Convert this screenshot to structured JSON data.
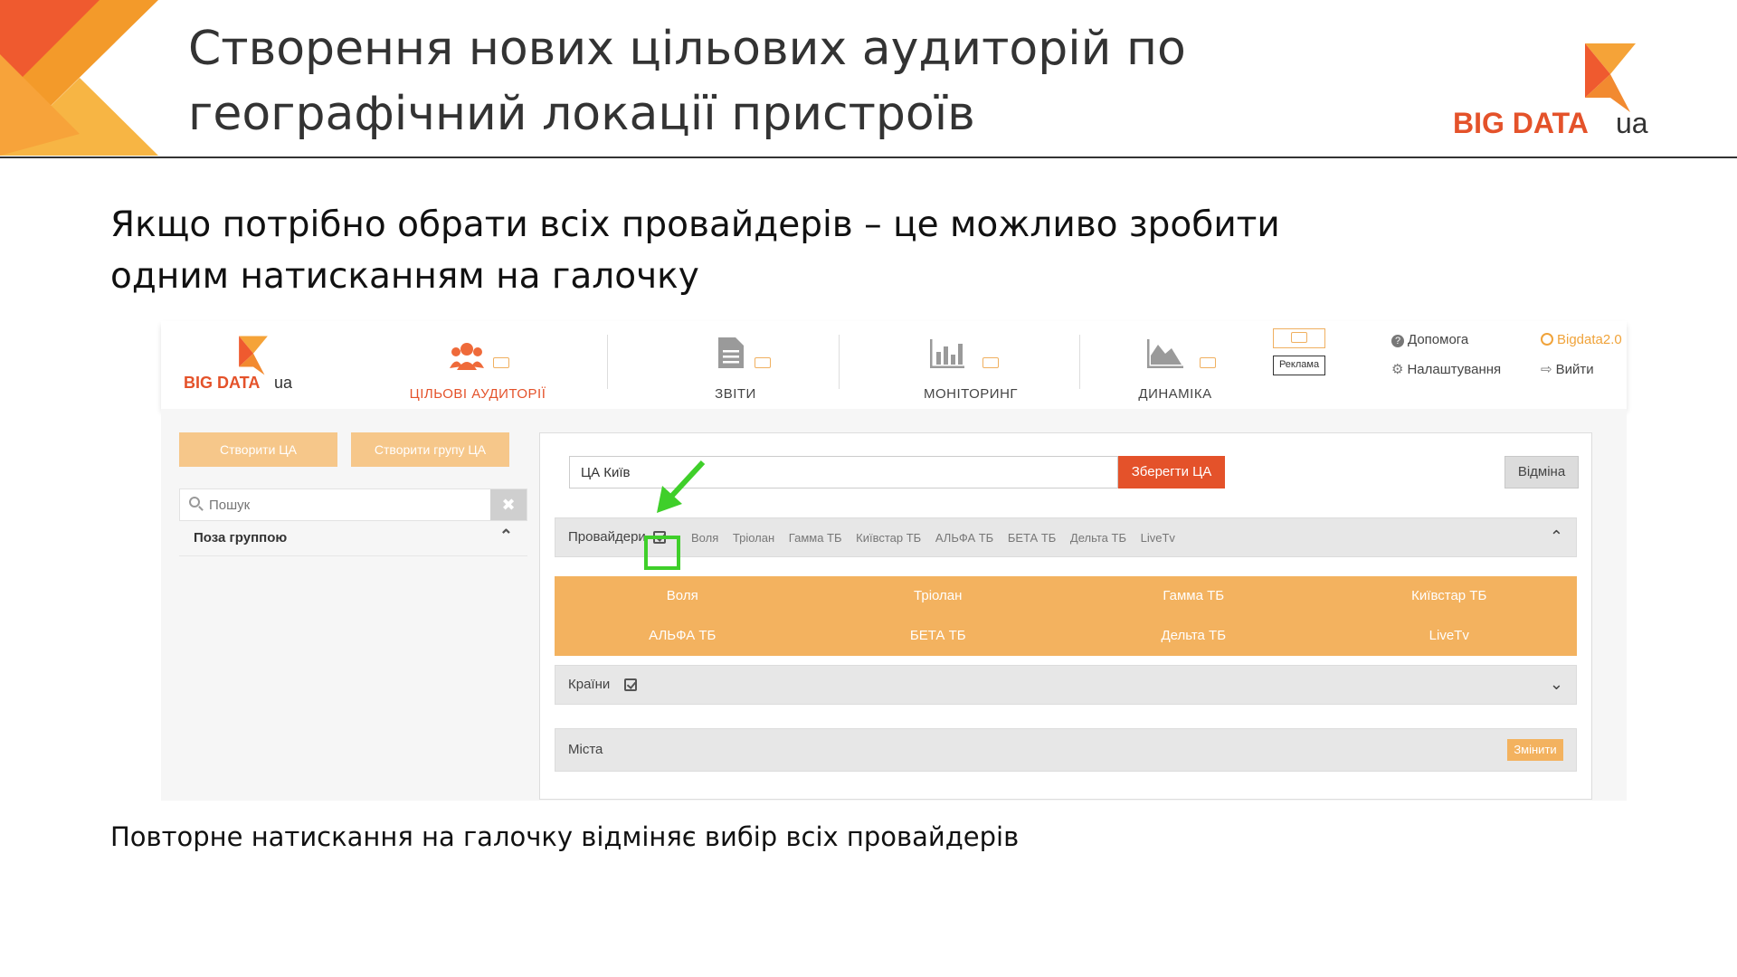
{
  "slide": {
    "title_line1": "Створення нових цільових аудиторій по",
    "title_line2": "географічний локації пристроїв",
    "logo_text": "BIG DATA",
    "logo_suffix": "ua",
    "intro_line1": "Якщо потрібно обрати всіх провайдерів – це можливо зробити",
    "intro_line2": "одним натисканням на галочку",
    "footnote": "Повторне натискання на галочку відміняє вибір всіх провайдерів"
  },
  "app": {
    "logo_text": "BIG DATA",
    "logo_suffix": "ua",
    "nav": [
      {
        "label": "ЦІЛЬОВІ АУДИТОРІЇ",
        "icon": "users-icon",
        "active": true
      },
      {
        "label": "ЗВІТИ",
        "icon": "document-icon",
        "active": false
      },
      {
        "label": "МОНІТОРИНГ",
        "icon": "bar-chart-icon",
        "active": false
      },
      {
        "label": "ДИНАМІКА",
        "icon": "area-chart-icon",
        "active": false
      }
    ],
    "ad_label": "Реклама",
    "help": "Допомога",
    "settings": "Налаштування",
    "user": "Bigdata2.0",
    "logout": "Вийти",
    "sidebar": {
      "create_ca": "Створити ЦА",
      "create_group": "Створити групу ЦА",
      "search_placeholder": "Пошук",
      "group_label": "Поза группою"
    },
    "editor": {
      "name_value": "ЦА Київ",
      "save_label": "Зберегти ЦА",
      "cancel_label": "Відміна",
      "providers_label": "Провайдери",
      "provider_tags": [
        "Воля",
        "Тріолан",
        "Гамма ТБ",
        "Київстар ТБ",
        "АЛЬФА ТБ",
        "БЕТА ТБ",
        "Дельта ТБ",
        "LiveTv"
      ],
      "providers": [
        "Воля",
        "Тріолан",
        "Гамма ТБ",
        "Київстар ТБ",
        "АЛЬФА ТБ",
        "БЕТА ТБ",
        "Дельта ТБ",
        "LiveTv"
      ],
      "countries_label": "Країни",
      "cities_label": "Міста",
      "change_label": "Змінити"
    }
  },
  "colors": {
    "accent": "#e4522a",
    "peach": "#f3b25f",
    "highlight": "#3fcf2a"
  }
}
